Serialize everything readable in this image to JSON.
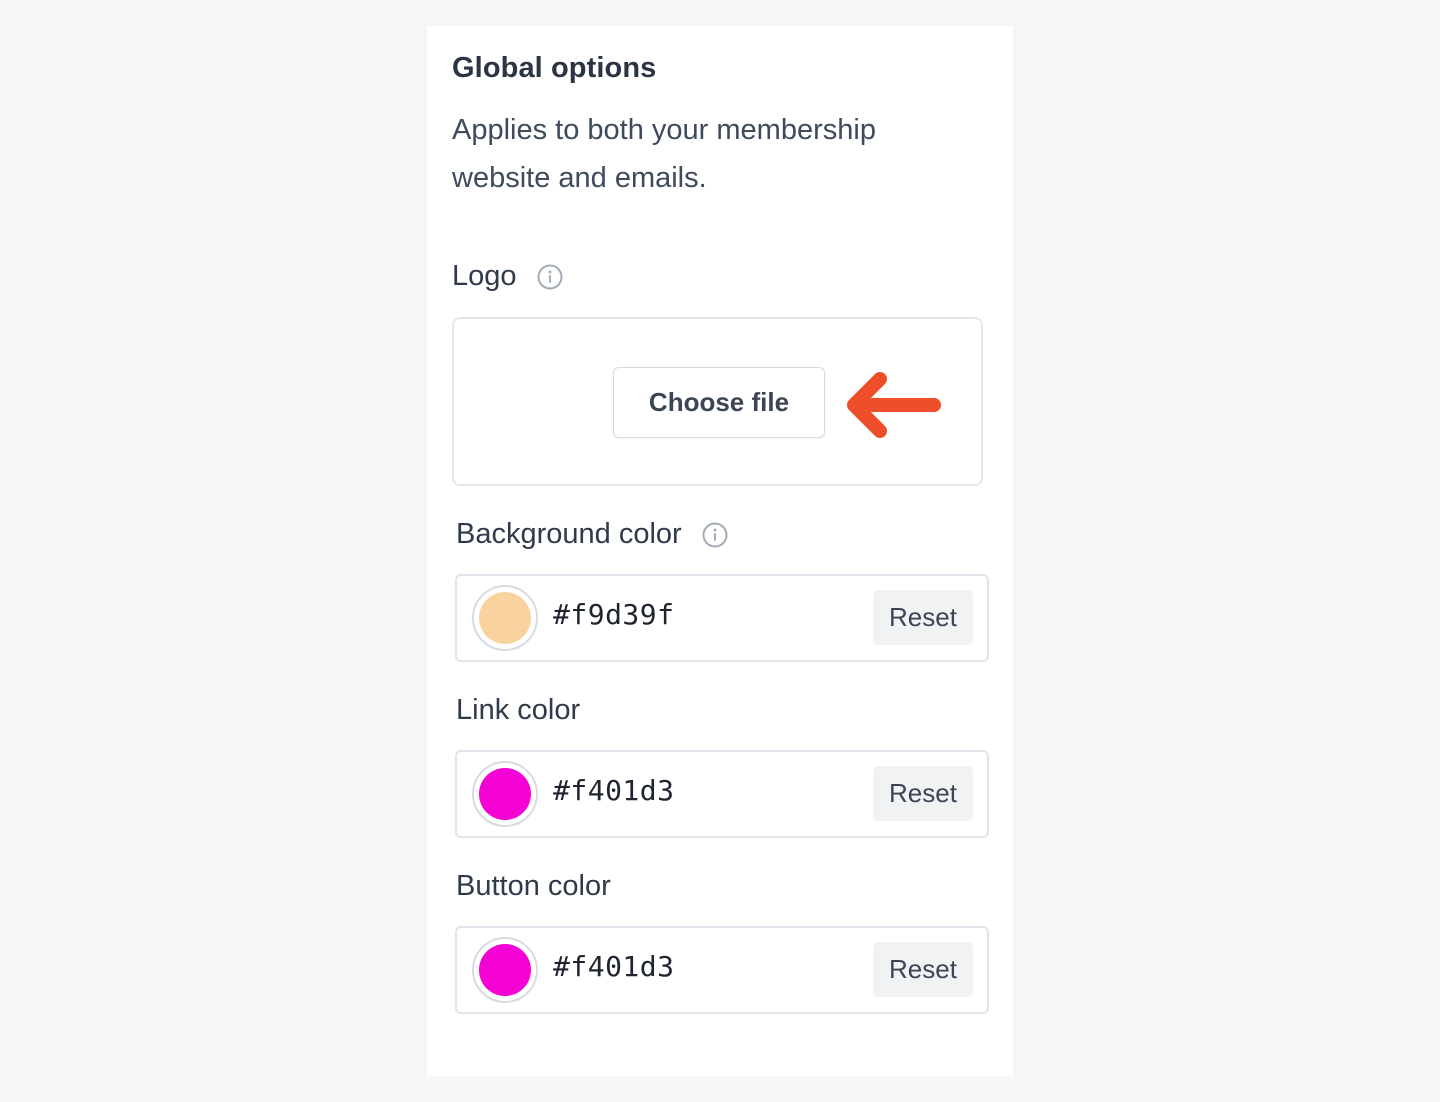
{
  "global_options": {
    "title": "Global options",
    "subtitle": "Applies to both your membership website and emails."
  },
  "logo": {
    "label": "Logo",
    "choose_file_label": "Choose file"
  },
  "background_color": {
    "label": "Background color",
    "value": "#f9d39f",
    "swatch": "#f9d39f",
    "reset_label": "Reset"
  },
  "link_color": {
    "label": "Link color",
    "value": "#f401d3",
    "swatch": "#f401d3",
    "reset_label": "Reset"
  },
  "button_color": {
    "label": "Button color",
    "value": "#f401d3",
    "swatch": "#f401d3",
    "reset_label": "Reset"
  },
  "icons": {
    "info": "info-icon",
    "arrow": "arrow-left-icon"
  },
  "colors": {
    "arrow": "#ef4e2b",
    "info_icon": "#a4acb9"
  }
}
